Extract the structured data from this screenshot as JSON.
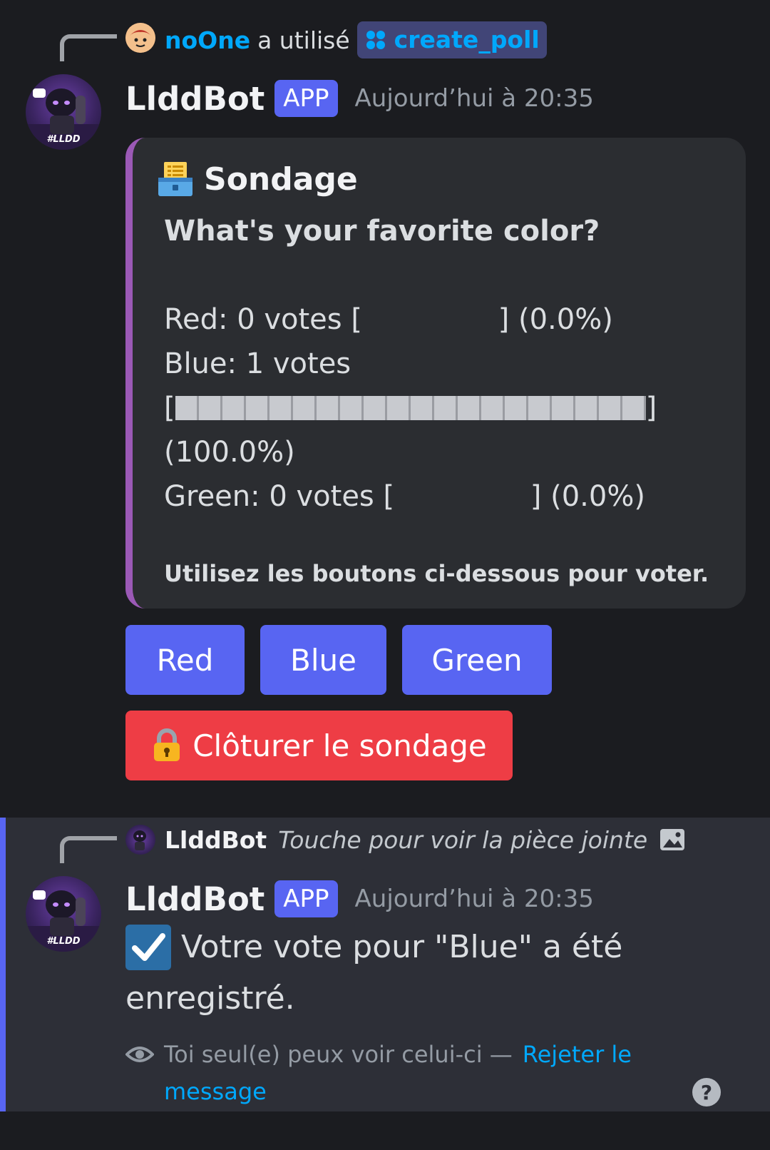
{
  "message1": {
    "reply": {
      "user": "noOne",
      "text": "a utilisé",
      "command": "create_poll"
    },
    "author": "LlddBot",
    "badge": "APP",
    "timestamp": "Aujourd’hui à 20:35",
    "avatar_text": "#LLDD",
    "embed": {
      "accent_color": "#9b59b6",
      "title_emoji": "ballot-box-icon",
      "title": "Sondage",
      "question": "What's your favorite color?",
      "lines": [
        "Red: 0 votes [               ] (0.0%)",
        "Blue: 1 votes",
        "[",
        "]",
        "(100.0%)",
        "Green: 0 votes [               ] (0.0%)"
      ],
      "bar_fill_fraction": 1.0,
      "footer": "Utilisez les boutons ci-dessous pour voter."
    },
    "buttons": [
      "Red",
      "Blue",
      "Green"
    ],
    "close_button": "Clôturer le sondage"
  },
  "message2": {
    "reply": {
      "user": "LlddBot",
      "text": "Touche pour voir la pièce jointe"
    },
    "author": "LlddBot",
    "badge": "APP",
    "timestamp": "Aujourd’hui à 20:35",
    "content_line1": "Votre vote pour \"Blue\" a été",
    "content_line2": "enregistré.",
    "ephemeral_note": "Toi seul(e) peux voir celui-ci —",
    "dismiss_line1": "Rejeter le",
    "dismiss_line2": "message"
  }
}
